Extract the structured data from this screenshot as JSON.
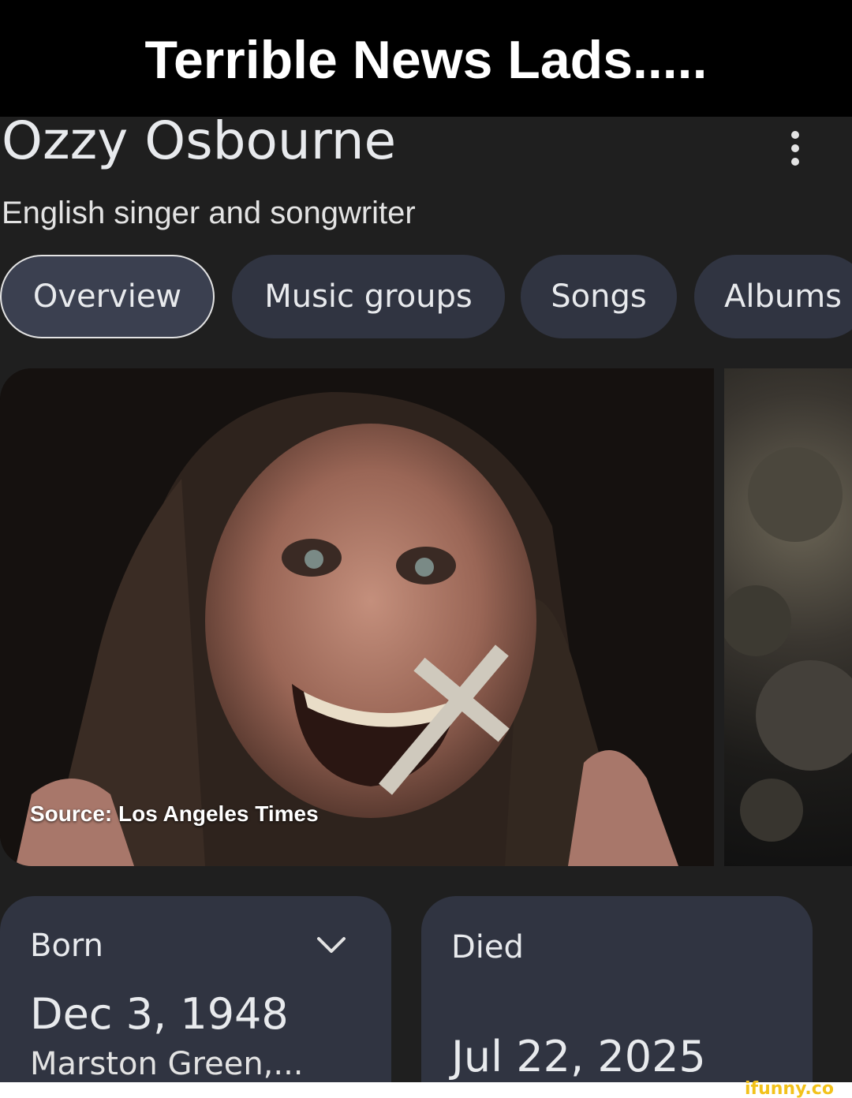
{
  "caption": "Terrible News Lads.....",
  "entity": {
    "name": "Ozzy Osbourne",
    "description": "English singer and songwriter"
  },
  "tabs": [
    {
      "label": "Overview",
      "active": true
    },
    {
      "label": "Music groups"
    },
    {
      "label": "Songs"
    },
    {
      "label": "Albums"
    }
  ],
  "image": {
    "source": "Source: Los Angeles Times"
  },
  "born": {
    "label": "Born",
    "date": "Dec 3, 1948",
    "place": "Marston Green,..."
  },
  "died": {
    "label": "Died",
    "date": "Jul 22, 2025"
  },
  "watermark": "ifunny.co",
  "colors": {
    "background": "#1f1f1f",
    "chip": "#303441",
    "caption_bar": "#000000",
    "watermark": "#f2c21b"
  }
}
